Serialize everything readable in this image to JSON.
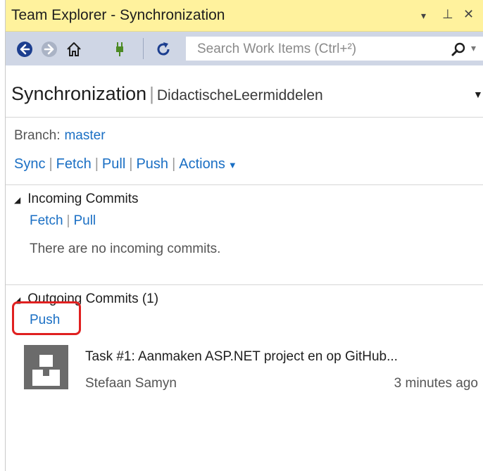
{
  "window": {
    "title": "Team Explorer - Synchronization",
    "controls": [
      "▾",
      "⊥",
      "✕"
    ]
  },
  "toolbar": {
    "icons": [
      "back-icon",
      "forward-icon",
      "home-icon",
      "connect-icon",
      "refresh-icon"
    ],
    "search_placeholder": "Search Work Items (Ctrl+²)"
  },
  "header": {
    "title": "Synchronization",
    "separator": "|",
    "repo": "DidactischeLeermiddelen"
  },
  "branch": {
    "label": "Branch:",
    "value": "master"
  },
  "actions": [
    "Sync",
    "Fetch",
    "Pull",
    "Push",
    "Actions"
  ],
  "separator": "|",
  "incoming": {
    "title": "Incoming Commits",
    "links": [
      "Fetch",
      "Pull"
    ],
    "message": "There are no incoming commits."
  },
  "outgoing": {
    "title": "Outgoing Commits (1)",
    "link": "Push",
    "commits": [
      {
        "message": "Task #1: Aanmaken ASP.NET project en op GitHub...",
        "author": "Stefaan Samyn",
        "time": "3 minutes ago"
      }
    ]
  },
  "colors": {
    "title_bar": "#fff29d",
    "toolbar": "#cfd6e5",
    "link": "#1a6fc4",
    "highlight": "#e02020",
    "avatar": "#6b6b6b"
  }
}
